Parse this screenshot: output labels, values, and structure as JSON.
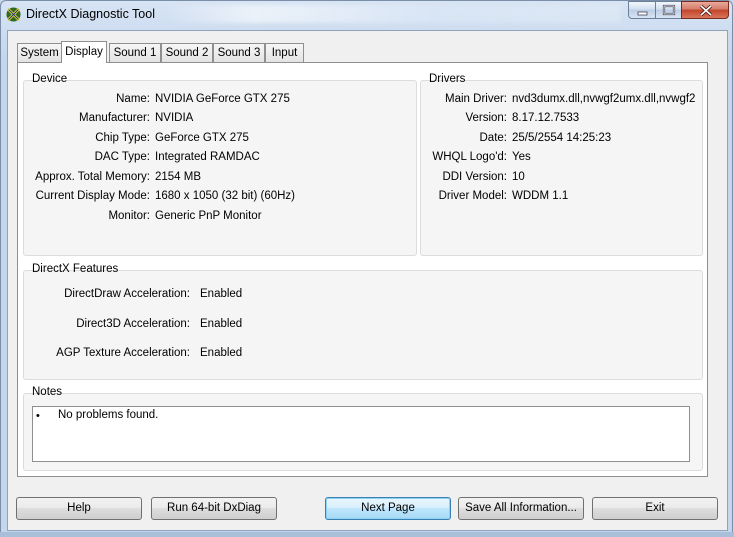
{
  "window": {
    "title": "DirectX Diagnostic Tool",
    "accent": "#c4d6ec"
  },
  "tabs": [
    {
      "label": "System",
      "active": false
    },
    {
      "label": "Display",
      "active": true
    },
    {
      "label": "Sound 1",
      "active": false
    },
    {
      "label": "Sound 2",
      "active": false
    },
    {
      "label": "Sound 3",
      "active": false
    },
    {
      "label": "Input",
      "active": false
    }
  ],
  "device": {
    "heading": "Device",
    "rows": [
      {
        "label": "Name:",
        "value": "NVIDIA GeForce GTX 275"
      },
      {
        "label": "Manufacturer:",
        "value": "NVIDIA"
      },
      {
        "label": "Chip Type:",
        "value": "GeForce GTX 275"
      },
      {
        "label": "DAC Type:",
        "value": "Integrated RAMDAC"
      },
      {
        "label": "Approx. Total Memory:",
        "value": "2154 MB"
      },
      {
        "label": "Current Display Mode:",
        "value": "1680 x 1050 (32 bit) (60Hz)"
      },
      {
        "label": "Monitor:",
        "value": "Generic PnP Monitor"
      }
    ]
  },
  "drivers": {
    "heading": "Drivers",
    "rows": [
      {
        "label": "Main Driver:",
        "value": "nvd3dumx.dll,nvwgf2umx.dll,nvwgf2"
      },
      {
        "label": "Version:",
        "value": "8.17.12.7533"
      },
      {
        "label": "Date:",
        "value": "25/5/2554 14:25:23"
      },
      {
        "label": "WHQL Logo'd:",
        "value": "Yes"
      },
      {
        "label": "DDI Version:",
        "value": "10"
      },
      {
        "label": "Driver Model:",
        "value": "WDDM 1.1"
      }
    ]
  },
  "features": {
    "heading": "DirectX Features",
    "rows": [
      {
        "label": "DirectDraw Acceleration:",
        "value": "Enabled"
      },
      {
        "label": "Direct3D Acceleration:",
        "value": "Enabled"
      },
      {
        "label": "AGP Texture Acceleration:",
        "value": "Enabled"
      }
    ]
  },
  "notes": {
    "heading": "Notes",
    "bullet": "•",
    "items": [
      "No problems found."
    ]
  },
  "buttons": {
    "help": "Help",
    "run64": "Run 64-bit DxDiag",
    "next": "Next Page",
    "save": "Save All Information...",
    "exit": "Exit"
  },
  "icons": {
    "app": "directx-x-icon",
    "minimize": "minimize-icon",
    "maximize": "maximize-icon",
    "close": "close-icon"
  }
}
